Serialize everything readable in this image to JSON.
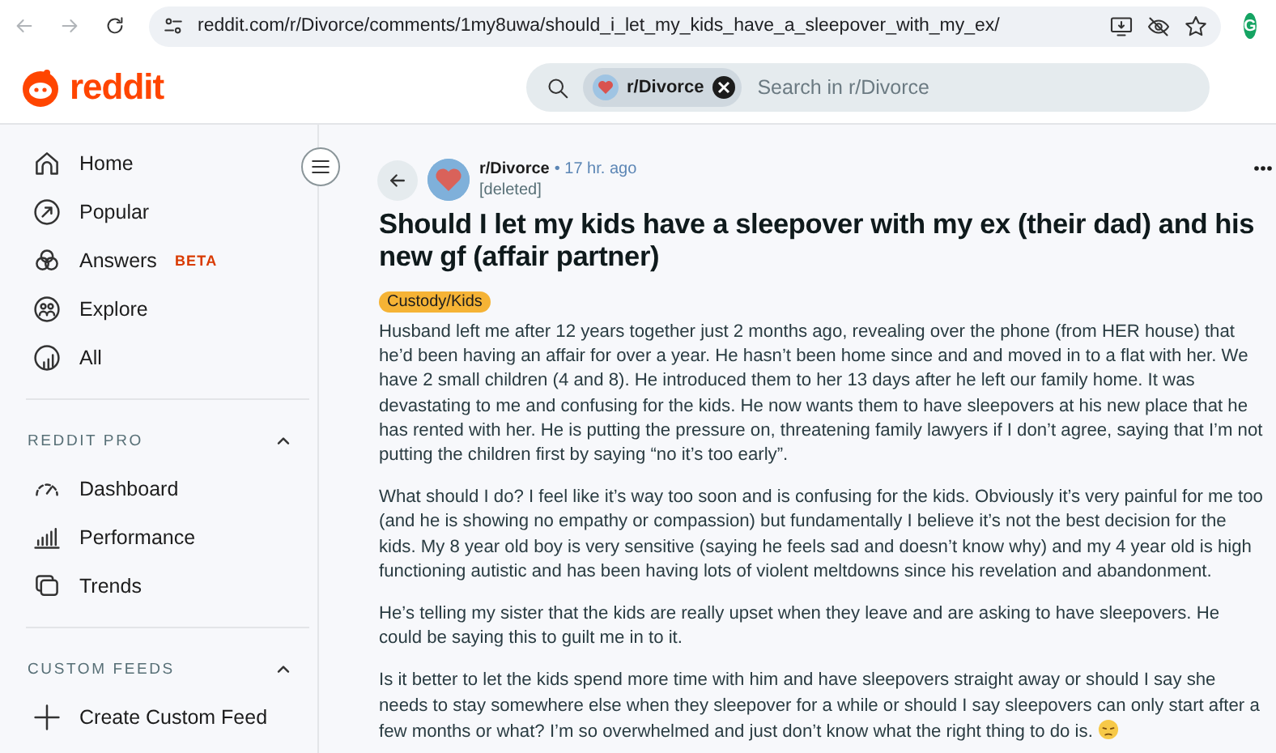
{
  "browser": {
    "url": "reddit.com/r/Divorce/comments/1my8uwa/should_i_let_my_kids_have_a_sleepover_with_my_ex/",
    "back_disabled": true,
    "extension_letter": "G"
  },
  "header": {
    "logo_text": "reddit",
    "search": {
      "chip": "r/Divorce",
      "placeholder": "Search in r/Divorce"
    }
  },
  "sidebar": {
    "items": [
      {
        "kind": "home",
        "label": "Home"
      },
      {
        "kind": "popular",
        "label": "Popular"
      },
      {
        "kind": "answers",
        "label": "Answers",
        "badge": "BETA"
      },
      {
        "kind": "explore",
        "label": "Explore"
      },
      {
        "kind": "all",
        "label": "All"
      }
    ],
    "sections": [
      {
        "title": "REDDIT PRO",
        "expanded": true,
        "items": [
          {
            "kind": "dashboard",
            "label": "Dashboard"
          },
          {
            "kind": "performance",
            "label": "Performance"
          },
          {
            "kind": "trends",
            "label": "Trends"
          }
        ]
      },
      {
        "title": "CUSTOM FEEDS",
        "expanded": true,
        "items": [
          {
            "kind": "create",
            "label": "Create Custom Feed"
          }
        ]
      }
    ]
  },
  "post": {
    "subreddit": "r/Divorce",
    "separator": "•",
    "time": "17 hr. ago",
    "author": "[deleted]",
    "title": "Should I let my kids have a sleepover with my ex (their dad) and his new gf (affair partner)",
    "flair": "Custody/Kids",
    "paragraphs": [
      "Husband left me after 12 years together just 2 months ago, revealing over the phone (from HER house) that he’d been having an affair for over a year. He hasn’t been home since and and moved in to a flat with her. We have 2 small children (4 and 8). He introduced them to her 13 days after he left our family home. It was devastating to me and confusing for the kids. He now wants them to have sleepovers at his new place that he has rented with her. He is putting the pressure on, threatening family lawyers if I don’t agree, saying that I’m not putting the children first by saying “no it’s too early”.",
      "What should I do? I feel like it’s way too soon and is confusing for the kids. Obviously it’s very painful for me too (and he is showing no empathy or compassion) but fundamentally I believe it’s not the best decision for the kids. My 8 year old boy is very sensitive (saying he feels sad and doesn’t know why) and my 4 year old is high functioning autistic and has been having lots of violent meltdowns since his revelation and abandonment.",
      "He’s telling my sister that the kids are really upset when they leave and are asking to have sleepovers. He could be saying this to guilt me in to it.",
      "Is it better to let the kids spend more time with him and have sleepovers straight away or should I say she needs to stay somewhere else when they sleepover for a while or should I say sleepovers can only start after a few months or what? I’m so overwhelmed and just don’t know what the right thing to do is."
    ],
    "ends_with_emoji": true
  }
}
